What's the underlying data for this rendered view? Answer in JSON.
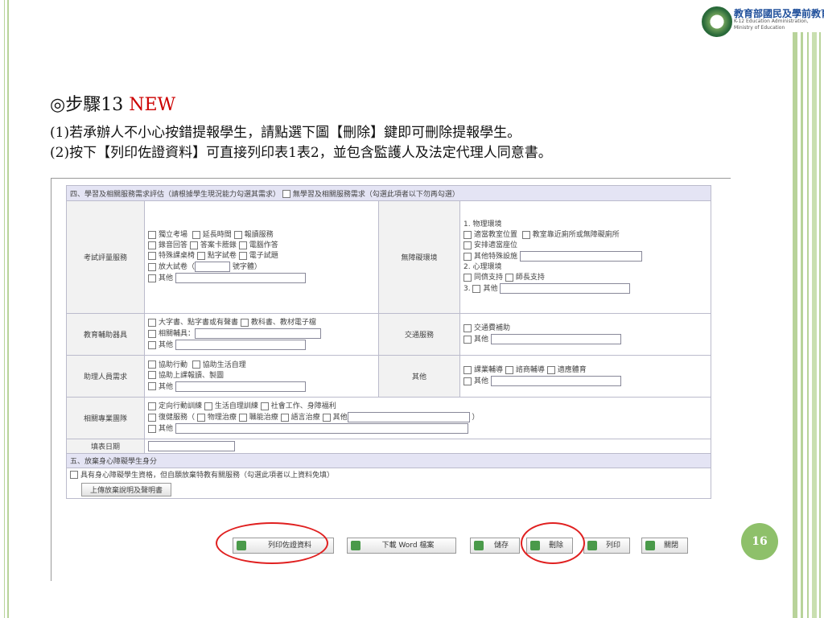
{
  "logo": {
    "title": "教育部國民及學前教育署",
    "subtitle_line1": "K-12 Education Administration,",
    "subtitle_line2": "Ministry of Education"
  },
  "slide": {
    "title_prefix": "◎步驟13 ",
    "title_new": "NEW",
    "line1": "(1)若承辦人不小心按錯提報學生，請點選下圖【刪除】鍵即可刪除提報學生。",
    "line2": "(2)按下【列印佐證資料】可直接列印表1表2，並包含監護人及法定代理人同意書。",
    "page_number": "16"
  },
  "form": {
    "section4_header": "四、學習及相關服務需求評估（請根據學生現況能力勾選其需求）",
    "section4_header_tail": "無學習及相關服務需求（勾選此項者以下勿再勾選）",
    "exam": {
      "label": "考試評量服務",
      "r1": [
        "獨立考場",
        "延長時間",
        "報讀服務"
      ],
      "r2": [
        "錄音回答",
        "答案卡謄錄",
        "電腦作答"
      ],
      "r3": [
        "特殊課桌椅",
        "點字試卷",
        "電子試題"
      ],
      "r4_a": "放大試卷（",
      "r4_b": "號字體）",
      "r5": "其他"
    },
    "barrier": {
      "label": "無障礙環境",
      "h1": "1. 物理環境",
      "p1": "適當教室位置",
      "p2": "教室靠近廁所或無障礙廁所",
      "p3": "安排適當座位",
      "p4": "其他特殊設施",
      "h2": "2. 心理環境",
      "m1": "同儕支持",
      "m2": "師長支持",
      "h3": "3.",
      "o": "其他"
    },
    "aids": {
      "label": "教育輔助器具",
      "r1a": "大字書、點字書或有聲書",
      "r1b": "教科書、教材電子檔",
      "r2": "相關輔具：",
      "r3": "其他"
    },
    "transport": {
      "label": "交通服務",
      "r1": "交通費補助",
      "r2": "其他"
    },
    "assistant": {
      "label": "助理人員需求",
      "r1": [
        "協助行動",
        "協助生活自理"
      ],
      "r2": "協助上課報讀、製圖",
      "r3": "其他"
    },
    "other": {
      "label": "其他",
      "r1": [
        "課業輔導",
        "諮商輔導",
        "適應體育"
      ],
      "r2": "其他"
    },
    "team": {
      "label": "相關專業團隊",
      "r1": [
        "定向行動訓練",
        "生活自理訓練",
        "社會工作、身障福利"
      ],
      "r2_a": "復健服務（",
      "r2_items": [
        "物理治療",
        "職能治療",
        "語言治療",
        "其他"
      ],
      "r2_end": "）",
      "r3": "其他"
    },
    "date_label": "填表日期",
    "section5_header": "五、放棄身心障礙學生身分",
    "waiver": "具有身心障礙學生資格，但自願放棄特教有關服務（勾選此項者以上資料免填）",
    "upload_button": "上傳放棄說明及聲明書",
    "buttons": {
      "print_evidence": "列印佐證資料",
      "download_word": "下載 Word 檔案",
      "save": "儲存",
      "delete": "刪除",
      "print": "列印",
      "close": "關閉"
    }
  },
  "colors": {
    "accent_red": "#cc0000",
    "frame_green": "#8ec06a",
    "header_bg": "#e4e4f4"
  }
}
